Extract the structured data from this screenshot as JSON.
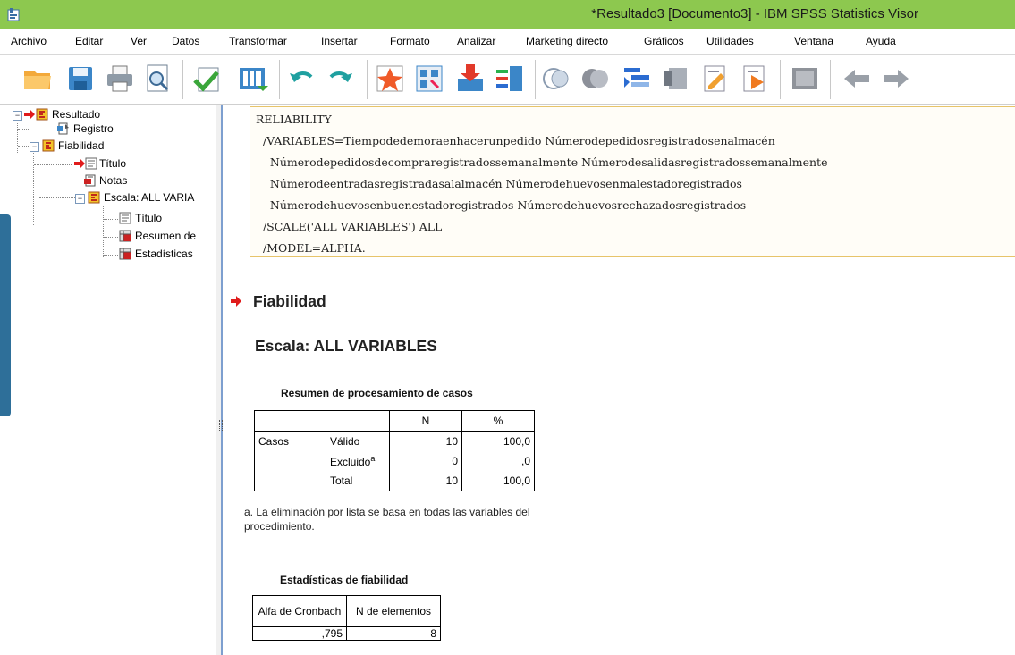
{
  "window": {
    "title": "*Resultado3 [Documento3] - IBM SPSS Statistics Visor"
  },
  "menu": [
    "Archivo",
    "Editar",
    "Ver",
    "Datos",
    "Transformar",
    "Insertar",
    "Formato",
    "Analizar",
    "Marketing directo",
    "Gráficos",
    "Utilidades",
    "Ventana",
    "Ayuda"
  ],
  "toolbar_icons": [
    "open-icon",
    "save-icon",
    "print-icon",
    "print-preview-icon",
    "export-icon",
    "goto-data-icon",
    "undo-icon",
    "redo-icon",
    "goto-case-icon",
    "goto-variable-icon",
    "insert-cases-icon",
    "insert-variables-icon",
    "show-all-icon",
    "hide-icon",
    "promote-icon",
    "demote-icon",
    "insert-heading-icon",
    "insert-title-icon",
    "insert-text-icon",
    "designate-window-icon",
    "back-icon",
    "forward-icon"
  ],
  "tree": {
    "resultado": "Resultado",
    "registro": "Registro",
    "fiabilidad": "Fiabilidad",
    "titulo": "Título",
    "notas": "Notas",
    "escala": "Escala: ALL VARIA",
    "escala_titulo": "Título",
    "resumen": "Resumen de",
    "estadisticas": "Estadísticas"
  },
  "syntax": [
    "RELIABILITY",
    "  /VARIABLES=Tiempodedemoraenhacerunpedido Númerodepedidosregistradosenalmacén",
    "    Númerodepedidosdecompraregistradossemanalmente Númerodesalidasregistradossemanalmente",
    "    Númerodeentradasregistradasalalmacén Númerodehuevosenmalestadoregistrados",
    "    Númerodehuevosenbuenestadoregistrados Númerodehuevosrechazadosregistrados",
    "  /SCALE('ALL VARIABLES') ALL",
    "  /MODEL=ALPHA."
  ],
  "headings": {
    "fiabilidad": "Fiabilidad",
    "escala": "Escala: ALL VARIABLES"
  },
  "case_summary": {
    "title": "Resumen de procesamiento de casos",
    "col_n": "N",
    "col_pct": "%",
    "group": "Casos",
    "rows": [
      {
        "label": "Válido",
        "sup": "",
        "n": "10",
        "pct": "100,0"
      },
      {
        "label": "Excluido",
        "sup": "a",
        "n": "0",
        "pct": ",0"
      },
      {
        "label": "Total",
        "sup": "",
        "n": "10",
        "pct": "100,0"
      }
    ],
    "footnote": "a. La eliminación por lista se basa en todas las variables del procedimiento."
  },
  "reliability": {
    "title": "Estadísticas de fiabilidad",
    "col_alpha": "Alfa de Cronbach",
    "col_n": "N de elementos",
    "alpha": ",795",
    "n": "8"
  }
}
